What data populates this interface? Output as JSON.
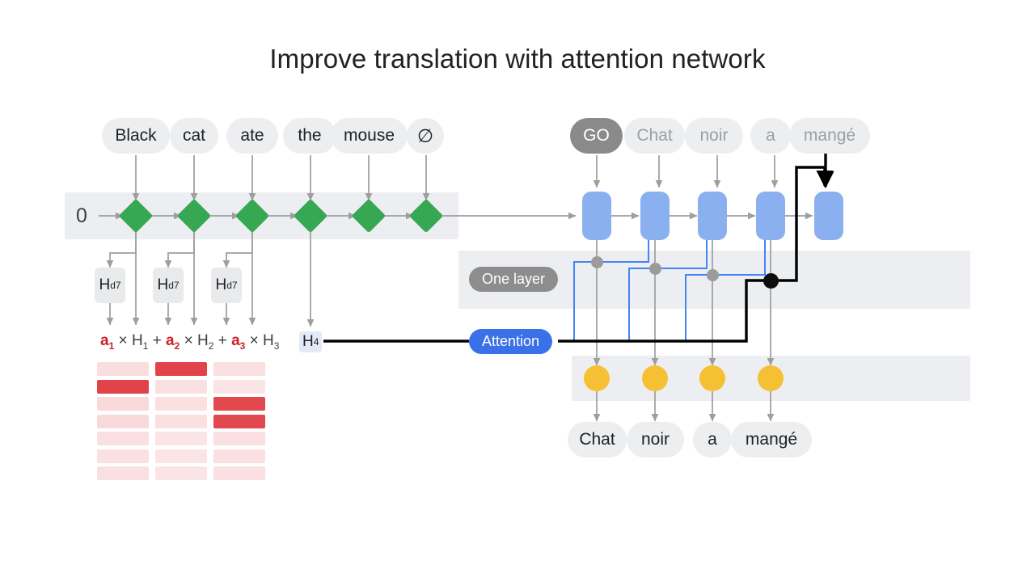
{
  "page": {
    "title": "Improve translation with attention network",
    "background": "#ffffff"
  },
  "colors": {
    "encoder_node": "#36a853",
    "decoder_cell": "#8ab0f0",
    "output_node": "#f5c033",
    "attention_pill": "#3b71e8",
    "layer_pill": "#8d8d8d",
    "heat_high": "#e0434a",
    "heat_low": "#fbe4e5",
    "coefficient_text": "#cc2127",
    "band": "#eceef1",
    "wire_gray": "#9e9e9e",
    "wire_blue": "#4285f4",
    "wire_black": "#000000"
  },
  "encoder": {
    "initial_state_label": "0",
    "input_tokens": [
      {
        "label": "Black"
      },
      {
        "label": "cat"
      },
      {
        "label": "ate"
      },
      {
        "label": "the"
      },
      {
        "label": "mouse"
      },
      {
        "label": "∅"
      }
    ],
    "hidden_boxes": [
      {
        "symbol": "H",
        "sub": "d7"
      },
      {
        "symbol": "H",
        "sub": "d7"
      },
      {
        "symbol": "H",
        "sub": "d7"
      }
    ],
    "context_box": {
      "symbol": "H",
      "sub": "4"
    },
    "formula": {
      "terms": [
        {
          "coef": "a",
          "coef_sub": "1",
          "times": "×",
          "state": "H",
          "state_sub": "1"
        },
        {
          "coef": "a",
          "coef_sub": "2",
          "times": "×",
          "state": "H",
          "state_sub": "2"
        },
        {
          "coef": "a",
          "coef_sub": "3",
          "times": "×",
          "state": "H",
          "state_sub": "3"
        }
      ],
      "plus": "+"
    }
  },
  "attention_map": {
    "rows": 7,
    "columns": 3,
    "weights": [
      [
        0.12,
        0.95,
        0.1
      ],
      [
        0.95,
        0.1,
        0.08
      ],
      [
        0.14,
        0.1,
        0.92
      ],
      [
        0.14,
        0.1,
        0.92
      ],
      [
        0.1,
        0.08,
        0.1
      ],
      [
        0.1,
        0.08,
        0.1
      ],
      [
        0.1,
        0.08,
        0.1
      ]
    ]
  },
  "decoder": {
    "layer_label": "One layer",
    "attention_label": "Attention",
    "input_tokens": [
      {
        "label": "GO",
        "style": "dark"
      },
      {
        "label": "Chat",
        "style": "muted"
      },
      {
        "label": "noir",
        "style": "muted"
      },
      {
        "label": "a",
        "style": "muted"
      },
      {
        "label": "mangé",
        "style": "muted"
      }
    ],
    "output_tokens": [
      {
        "label": "Chat"
      },
      {
        "label": "noir"
      },
      {
        "label": "a"
      },
      {
        "label": "mangé"
      }
    ]
  }
}
